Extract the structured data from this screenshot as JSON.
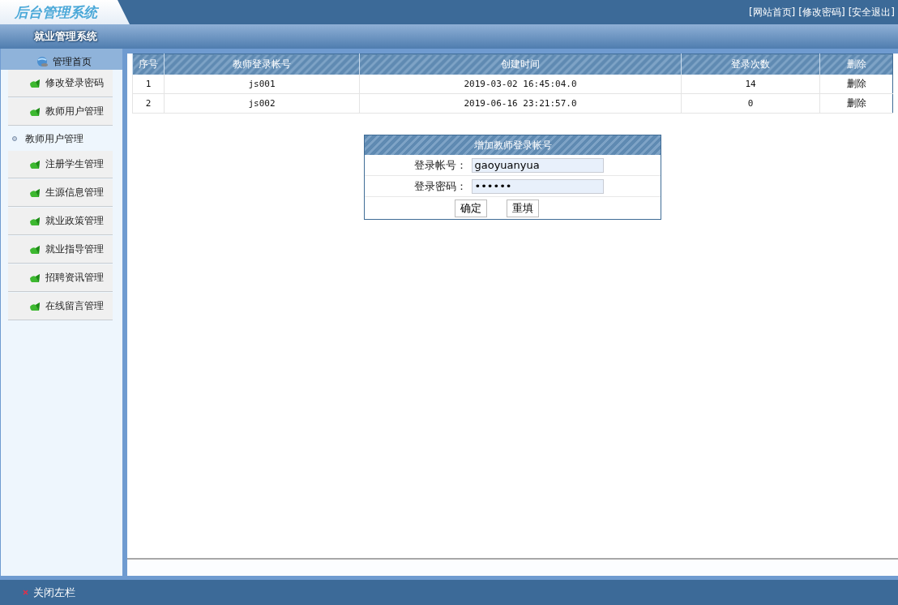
{
  "header": {
    "logo": "后台管理系统",
    "links": [
      "[网站首页]",
      "[修改密码]",
      "[安全退出]"
    ]
  },
  "subheader": {
    "title": "就业管理系统"
  },
  "sidebar": {
    "home": "管理首页",
    "items": [
      {
        "label": "修改登录密码",
        "kind": "menu"
      },
      {
        "label": "教师用户管理",
        "kind": "menu"
      },
      {
        "label": "教师用户管理",
        "kind": "submenu"
      },
      {
        "label": "注册学生管理",
        "kind": "menu"
      },
      {
        "label": "生源信息管理",
        "kind": "menu"
      },
      {
        "label": "就业政策管理",
        "kind": "menu"
      },
      {
        "label": "就业指导管理",
        "kind": "menu"
      },
      {
        "label": "招聘资讯管理",
        "kind": "menu"
      },
      {
        "label": "在线留言管理",
        "kind": "menu"
      }
    ]
  },
  "table": {
    "columns": [
      "序号",
      "教师登录帐号",
      "创建时间",
      "登录次数",
      "删除"
    ],
    "rows": [
      [
        "1",
        "js001",
        "2019-03-02 16:45:04.0",
        "14",
        "删除"
      ],
      [
        "2",
        "js002",
        "2019-06-16 23:21:57.0",
        "0",
        "删除"
      ]
    ]
  },
  "form": {
    "title": "增加教师登录帐号",
    "fields": [
      {
        "label": "登录帐号：",
        "value": "gaoyuanyua"
      },
      {
        "label": "登录密码：",
        "value": "••••••"
      }
    ],
    "buttons": [
      "确定",
      "重填"
    ]
  },
  "footer": {
    "toggle": "关闭左栏"
  }
}
